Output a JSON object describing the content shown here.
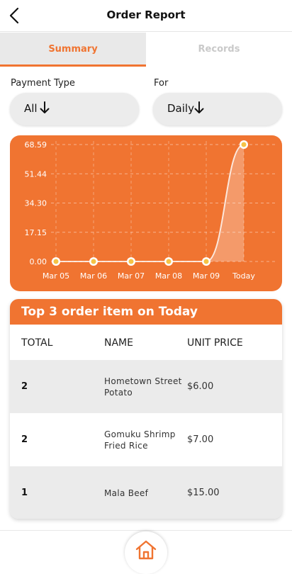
{
  "header": {
    "title": "Order Report",
    "back_icon": "chevron-left-icon"
  },
  "tabs": [
    {
      "label": "Summary",
      "active": true
    },
    {
      "label": "Records",
      "active": false
    }
  ],
  "filters": {
    "payment_type": {
      "label": "Payment Type",
      "value": "All",
      "icon": "arrow-down-icon"
    },
    "for": {
      "label": "For",
      "value": "Daily",
      "icon": "arrow-down-icon"
    }
  },
  "colors": {
    "accent": "#f07431",
    "row_grey": "#ebebeb",
    "tab_bg": "#e9e9e9"
  },
  "chart_data": {
    "type": "line",
    "categories": [
      "Mar 05",
      "Mar 06",
      "Mar 07",
      "Mar 08",
      "Mar 09",
      "Today"
    ],
    "values": [
      0,
      0,
      0,
      0,
      0,
      68.59
    ],
    "yticks": [
      "68.59",
      "51.44",
      "34.30",
      "17.15",
      "0.00"
    ],
    "ylim": [
      0,
      68.59
    ],
    "grid": true
  },
  "top_items": {
    "title": "Top 3 order item on Today",
    "columns": [
      "TOTAL",
      "NAME",
      "UNIT PRICE"
    ],
    "rows": [
      {
        "total": "2",
        "name": "Hometown Street Potato",
        "price": "$6.00"
      },
      {
        "total": "2",
        "name": "Gomuku Shrimp Fried Rice",
        "price": "$7.00"
      },
      {
        "total": "1",
        "name": "Mala Beef",
        "price": "$15.00"
      }
    ]
  },
  "nav": {
    "home_icon": "home-icon"
  }
}
